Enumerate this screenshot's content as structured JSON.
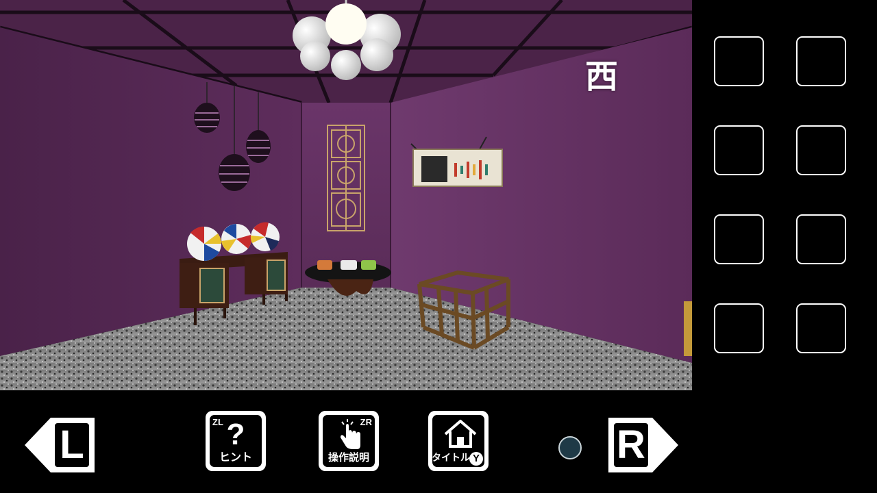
{
  "scene": {
    "direction": "西"
  },
  "inventory": {
    "slots": [
      "",
      "",
      "",
      "",
      "",
      "",
      "",
      ""
    ]
  },
  "toolbar": {
    "left_arrow": "L",
    "right_arrow": "R",
    "hint": {
      "label": "ヒント",
      "shortcut": "ZL",
      "glyph": "?"
    },
    "controls": {
      "label": "操作説明",
      "shortcut": "ZR"
    },
    "title": {
      "label": "タイトルへ",
      "shortcut": "Y"
    }
  },
  "colors": {
    "wall": "#5a2c5a",
    "ceiling": "#4a2447",
    "floor": "#8a8a8a",
    "page_indicator": "#1f3a47"
  }
}
